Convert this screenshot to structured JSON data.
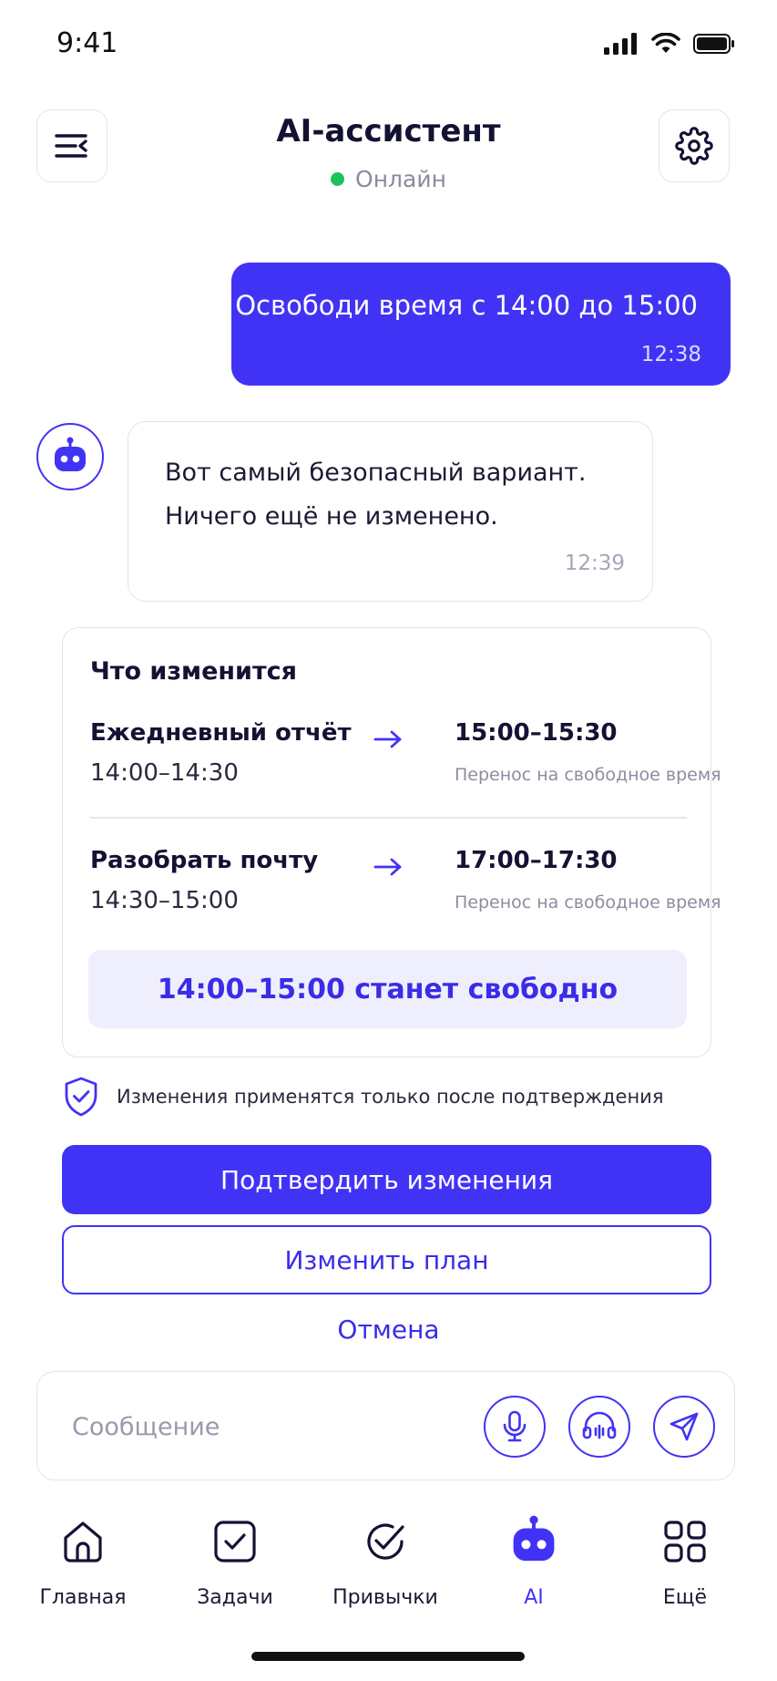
{
  "status_bar": {
    "time": "9:41"
  },
  "header": {
    "title": "AI-ассистент",
    "status": "Онлайн"
  },
  "messages": {
    "user": {
      "text": "Освободи время с 14:00 до 15:00",
      "time": "12:38"
    },
    "assistant": {
      "line1": "Вот самый безопасный вариант.",
      "line2": "Ничего ещё не изменено.",
      "time": "12:39"
    }
  },
  "changes": {
    "title": "Что изменится",
    "items": [
      {
        "task": "Ежедневный отчёт",
        "old_time": "14:00–14:30",
        "new_time": "15:00–15:30",
        "note": "Перенос на свободное время"
      },
      {
        "task": "Разобрать почту",
        "old_time": "14:30–15:00",
        "new_time": "17:00–17:30",
        "note": "Перенос на свободное время"
      }
    ],
    "result": "14:00–15:00 станет свободно"
  },
  "confirmation_note": "Изменения применятся только после подтверждения",
  "actions": {
    "confirm": "Подтвердить изменения",
    "edit": "Изменить план",
    "cancel": "Отмена"
  },
  "composer": {
    "placeholder": "Сообщение",
    "value": ""
  },
  "tabs": [
    {
      "label": "Главная",
      "icon": "home-icon",
      "active": false
    },
    {
      "label": "Задачи",
      "icon": "checkbox-icon",
      "active": false
    },
    {
      "label": "Привычки",
      "icon": "circle-check-icon",
      "active": false
    },
    {
      "label": "AI",
      "icon": "robot-icon",
      "active": true
    },
    {
      "label": "Ещё",
      "icon": "grid-icon",
      "active": false
    }
  ],
  "colors": {
    "accent": "#4133f5",
    "accent_soft": "#efeefc",
    "online": "#1ec25a",
    "text": "#141233",
    "muted": "#8d8ca0"
  }
}
